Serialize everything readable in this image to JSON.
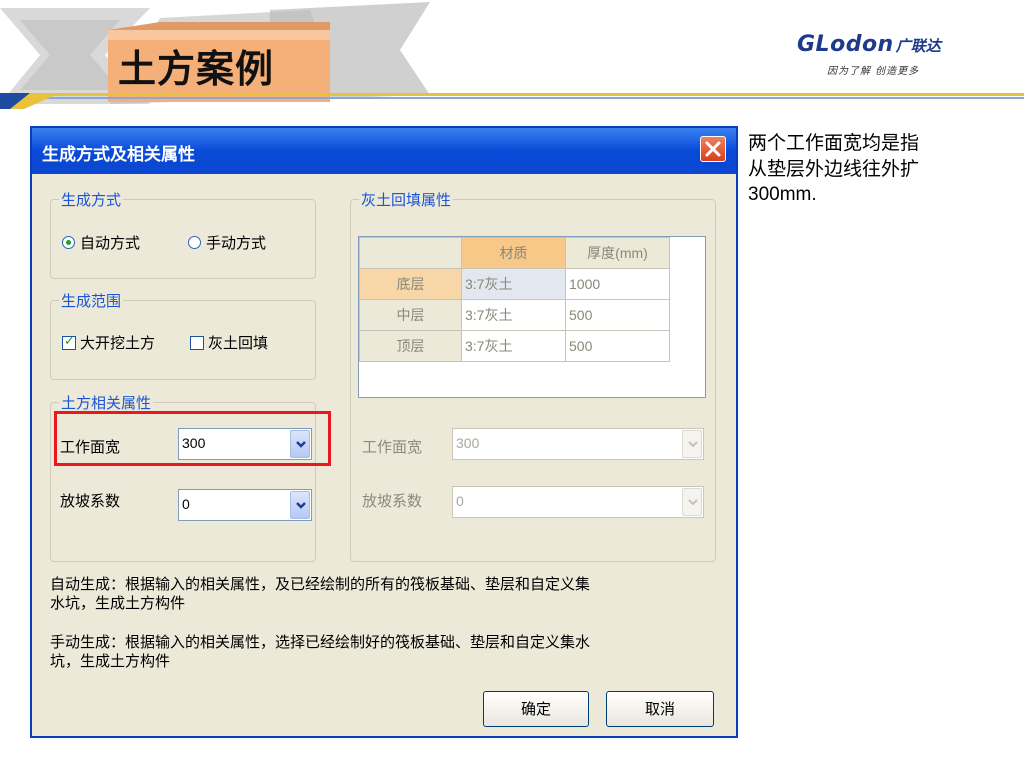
{
  "slide": {
    "title": "土方案例",
    "logo_main": "GLodon",
    "logo_cn": "广联达",
    "logo_slogan": "因为了解 创造更多",
    "note_line1": "两个工作面宽均是指",
    "note_line2": "从垫层外边线往外扩",
    "note_line3": "300mm."
  },
  "dialog": {
    "title": "生成方式及相关属性",
    "generation_mode": {
      "legend": "生成方式",
      "auto_label": "自动方式",
      "manual_label": "手动方式",
      "selected": "auto"
    },
    "generation_scope": {
      "legend": "生成范围",
      "excavation_label": "大开挖土方",
      "excavation_checked": true,
      "backfill_label": "灰土回填",
      "backfill_checked": false
    },
    "earthwork_props": {
      "legend": "土方相关属性",
      "work_width_label": "工作面宽",
      "work_width_value": "300",
      "slope_label": "放坡系数",
      "slope_value": "0"
    },
    "backfill_props": {
      "legend": "灰土回填属性",
      "columns": [
        "材质",
        "厚度(mm)"
      ],
      "rows": [
        {
          "layer": "底层",
          "material": "3:7灰土",
          "thickness": "1000"
        },
        {
          "layer": "中层",
          "material": "3:7灰土",
          "thickness": "500"
        },
        {
          "layer": "顶层",
          "material": "3:7灰土",
          "thickness": "500"
        }
      ],
      "work_width_label": "工作面宽",
      "work_width_value": "300",
      "slope_label": "放坡系数",
      "slope_value": "0"
    },
    "desc_auto_1": "自动生成：根据输入的相关属性，及已经绘制的所有的筏板基础、垫层和自定义集",
    "desc_auto_2": "水坑，生成土方构件",
    "desc_manual_1": "手动生成：根据输入的相关属性，选择已经绘制好的筏板基础、垫层和自定义集水",
    "desc_manual_2": "坑，生成土方构件",
    "ok_label": "确定",
    "cancel_label": "取消"
  },
  "colors": {
    "titlebar": "#0a4ad8",
    "legend_text": "#1c55d4",
    "highlight_box": "#e8181c",
    "banner_fill": "#f5b07a"
  }
}
